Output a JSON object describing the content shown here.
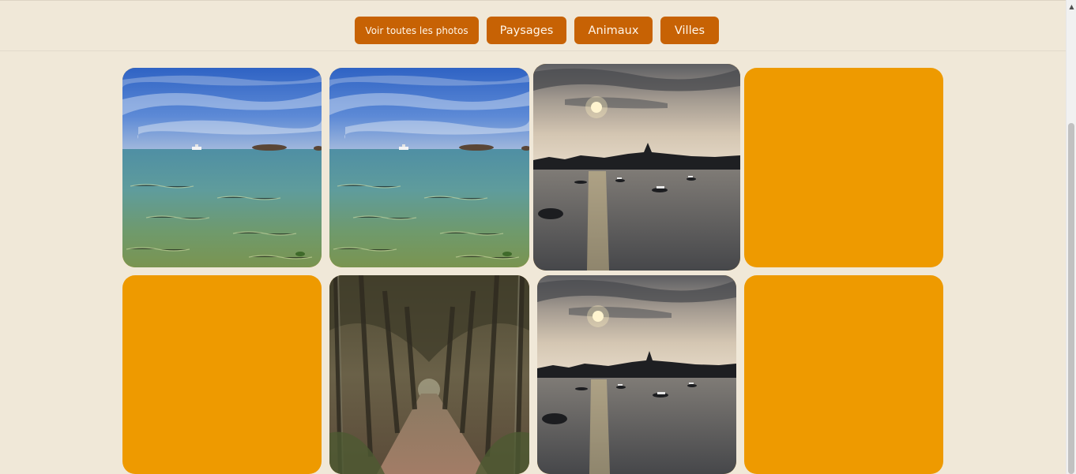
{
  "filters": {
    "all": "Voir toutes les photos",
    "landscapes": "Paysages",
    "animals": "Animaux",
    "cities": "Villes"
  },
  "gallery": {
    "tiles": [
      {
        "kind": "photo",
        "subject": "sea-with-islands"
      },
      {
        "kind": "photo",
        "subject": "sea-with-islands"
      },
      {
        "kind": "photo",
        "subject": "sunset-harbor"
      },
      {
        "kind": "placeholder",
        "color": "#ee9a00"
      },
      {
        "kind": "placeholder",
        "color": "#ee9a00"
      },
      {
        "kind": "photo",
        "subject": "forest-path"
      },
      {
        "kind": "photo",
        "subject": "sunset-harbor"
      },
      {
        "kind": "placeholder",
        "color": "#ee9a00"
      }
    ]
  },
  "colors": {
    "background": "#f0e8d8",
    "button": "#c76204",
    "button_text": "#fff6ea",
    "placeholder": "#ee9a00"
  },
  "icons": {
    "scroll_up": "triangle-up"
  }
}
